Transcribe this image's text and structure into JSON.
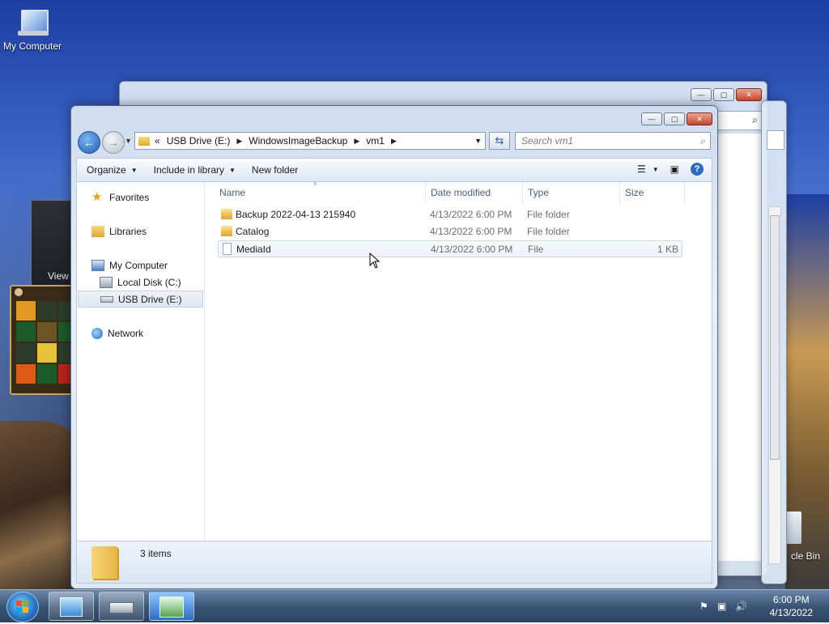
{
  "desktop": {
    "icons": [
      {
        "label": "My Computer"
      },
      {
        "label": "cle Bin"
      }
    ]
  },
  "background_windows": {
    "dark_panel_text": "View",
    "partial_text": "e"
  },
  "explorer": {
    "caption_buttons": {
      "minimize": "—",
      "maximize": "▢",
      "close": "✕"
    },
    "breadcrumbs": [
      "USB Drive (E:)",
      "WindowsImageBackup",
      "vm1"
    ],
    "breadcrumb_prefix": "«",
    "search_placeholder": "Search vm1",
    "toolbar": {
      "organize": "Organize",
      "include_in_library": "Include in library",
      "new_folder": "New folder"
    },
    "nav_pane": {
      "favorites": "Favorites",
      "libraries": "Libraries",
      "my_computer": "My Computer",
      "local_disk": "Local Disk (C:)",
      "usb_drive": "USB Drive (E:)",
      "network": "Network"
    },
    "columns": {
      "name": "Name",
      "date": "Date modified",
      "type": "Type",
      "size": "Size"
    },
    "files": [
      {
        "name": "Backup 2022-04-13 215940",
        "date": "4/13/2022 6:00 PM",
        "type": "File folder",
        "size": "",
        "kind": "folder"
      },
      {
        "name": "Catalog",
        "date": "4/13/2022 6:00 PM",
        "type": "File folder",
        "size": "",
        "kind": "folder"
      },
      {
        "name": "MediaId",
        "date": "4/13/2022 6:00 PM",
        "type": "File",
        "size": "1 KB",
        "kind": "file"
      }
    ],
    "status": {
      "item_count": "3 items"
    }
  },
  "taskbar": {
    "clock_time": "6:00 PM",
    "clock_date": "4/13/2022"
  }
}
